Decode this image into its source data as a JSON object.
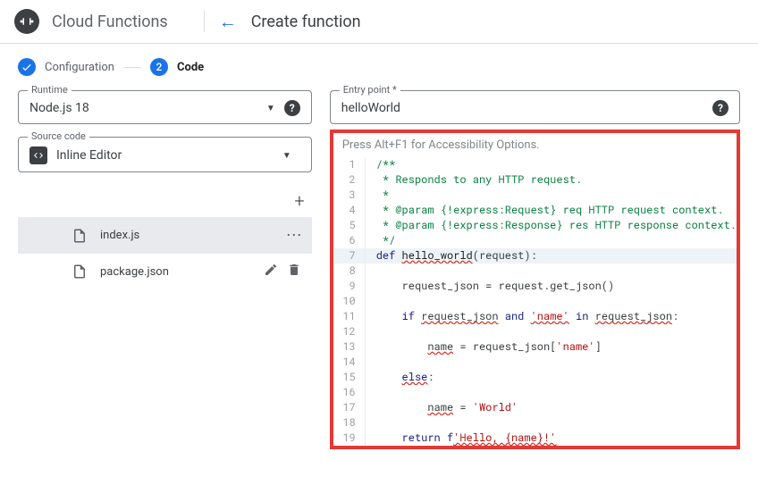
{
  "header": {
    "product": "Cloud Functions",
    "pageTitle": "Create function"
  },
  "stepper": {
    "step1": "Configuration",
    "step2Num": "2",
    "step2": "Code"
  },
  "runtime": {
    "label": "Runtime",
    "value": "Node.js 18"
  },
  "entry": {
    "label": "Entry point *",
    "value": "helloWorld"
  },
  "source": {
    "label": "Source code",
    "value": "Inline Editor"
  },
  "files": {
    "f0": "index.js",
    "f1": "package.json"
  },
  "editor": {
    "hint": "Press Alt+F1 for Accessibility Options.",
    "lines": {
      "l1": "/**",
      "l2": " * Responds to any HTTP request.",
      "l3": " *",
      "l4": " * @param {!express:Request} req HTTP request context.",
      "l5": " * @param {!express:Response} res HTTP response context.",
      "l6": " */",
      "l7a": "def ",
      "l7b": "hello_world",
      "l7c": "(request):",
      "l9": "    request_json = request.get_json()",
      "l11a": "    if ",
      "l11b": "request_json",
      "l11c": " and ",
      "l11d": "'name'",
      "l11e": " in ",
      "l11f": "request_json",
      "l11g": ":",
      "l13a": "        ",
      "l13b": "name",
      "l13c": " = request_json[",
      "l13d": "'name'",
      "l13e": "]",
      "l15a": "    ",
      "l15b": "else",
      "l15c": ":",
      "l17a": "        ",
      "l17b": "name",
      "l17c": " = ",
      "l17d": "'World'",
      "l19a": "    return f",
      "l19b": "'Hello, {name}!'"
    }
  }
}
